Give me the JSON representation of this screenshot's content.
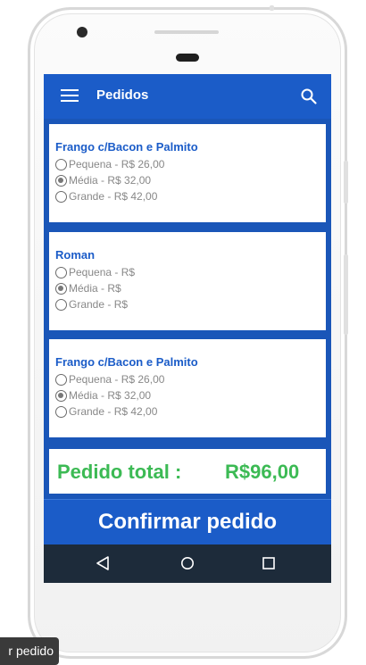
{
  "app": {
    "title": "Pedidos",
    "icons": {
      "menu": "menu-icon",
      "search": "search-icon"
    }
  },
  "orders": [
    {
      "name": "Frango c/Bacon e Palmito",
      "options": [
        {
          "label": "Pequena - R$ 26,00",
          "selected": false
        },
        {
          "label": "Média - R$ 32,00",
          "selected": true
        },
        {
          "label": "Grande - R$ 42,00",
          "selected": false
        }
      ]
    },
    {
      "name": "Roman",
      "options": [
        {
          "label": "Pequena - R$",
          "selected": false
        },
        {
          "label": "Média - R$",
          "selected": true
        },
        {
          "label": "Grande - R$",
          "selected": false
        }
      ]
    },
    {
      "name": "Frango c/Bacon e Palmito",
      "options": [
        {
          "label": "Pequena - R$ 26,00",
          "selected": false
        },
        {
          "label": "Média - R$ 32,00",
          "selected": true
        },
        {
          "label": "Grande - R$ 42,00",
          "selected": false
        }
      ]
    }
  ],
  "total": {
    "label": "Pedido total :",
    "value": "R$96,00"
  },
  "confirm_label": "Confirmar pedido",
  "navbar": {
    "icons": [
      "back-icon",
      "home-icon",
      "recent-apps-icon"
    ]
  },
  "tooltip": {
    "text": "r pedido"
  },
  "colors": {
    "primary": "#1b5cc8",
    "accent": "#3cba54",
    "navbar": "#1d2b3a"
  }
}
